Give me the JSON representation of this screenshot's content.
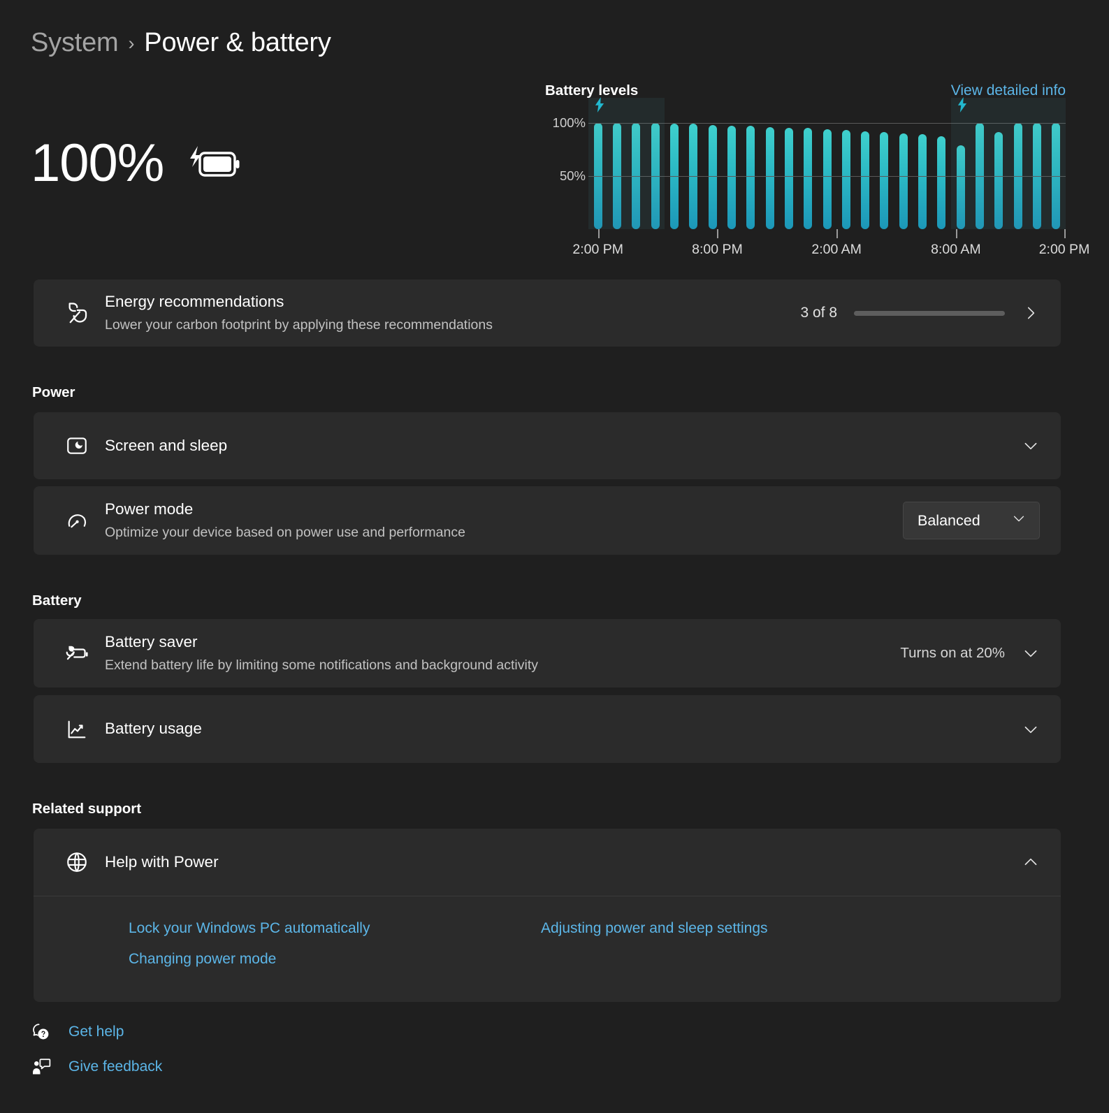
{
  "breadcrumb": {
    "parent": "System",
    "separator": "›",
    "current": "Power & battery"
  },
  "battery_status": {
    "percent_label": "100%",
    "icon": "battery-charging-icon"
  },
  "chart": {
    "title": "Battery levels",
    "detail_link": "View detailed info"
  },
  "chart_data": {
    "type": "bar",
    "title": "Battery levels",
    "xlabel": "",
    "ylabel": "",
    "ylim": [
      0,
      105
    ],
    "grid": true,
    "legend": false,
    "ytick_labels": [
      "100%",
      "50%"
    ],
    "ytick_values": [
      100,
      50
    ],
    "xtick_labels": [
      "2:00 PM",
      "8:00 PM",
      "2:00 AM",
      "8:00 AM",
      "2:00 PM"
    ],
    "xtick_hours": [
      0,
      6,
      12,
      18,
      24
    ],
    "bar_color": "#2bb8c4",
    "categories": [
      "2:00 PM",
      "3:00 PM",
      "4:00 PM",
      "5:00 PM",
      "6:00 PM",
      "7:00 PM",
      "8:00 PM",
      "9:00 PM",
      "10:00 PM",
      "11:00 PM",
      "12:00 AM",
      "1:00 AM",
      "2:00 AM",
      "3:00 AM",
      "4:00 AM",
      "5:00 AM",
      "6:00 AM",
      "7:00 AM",
      "8:00 AM",
      "9:00 AM",
      "10:00 AM",
      "11:00 AM",
      "12:00 PM",
      "1:00 PM",
      "2:00 PM"
    ],
    "values": [
      100,
      100,
      100,
      100,
      99,
      99,
      98,
      97,
      97,
      96,
      95,
      95,
      94,
      93,
      92,
      91,
      90,
      89,
      87,
      79,
      100,
      91,
      100,
      100,
      100
    ],
    "charging_periods": [
      {
        "start_index": 0,
        "end_index": 4,
        "label": "charging"
      },
      {
        "start_index": 19,
        "end_index": 25,
        "label": "charging"
      }
    ],
    "charging_icon": "lightning-bolt-icon"
  },
  "energy_card": {
    "icon": "leaf-icon",
    "title": "Energy recommendations",
    "subtitle": "Lower your carbon footprint by applying these recommendations",
    "progress_label": "3 of 8",
    "progress_value": 3,
    "progress_max": 8,
    "progress_color": "#0a7fe0",
    "chevron": "chevron-right-icon"
  },
  "power_section": {
    "heading": "Power",
    "items": [
      {
        "icon": "screen-sleep-icon",
        "title": "Screen and sleep",
        "subtitle": "",
        "value": "",
        "control": "chevron-down-icon"
      },
      {
        "icon": "power-mode-icon",
        "title": "Power mode",
        "subtitle": "Optimize your device based on power use and performance",
        "value": "Balanced",
        "control": "dropdown"
      }
    ]
  },
  "battery_section": {
    "heading": "Battery",
    "items": [
      {
        "icon": "battery-saver-icon",
        "title": "Battery saver",
        "subtitle": "Extend battery life by limiting some notifications and background activity",
        "value": "Turns on at 20%",
        "control": "chevron-down-icon"
      },
      {
        "icon": "battery-usage-icon",
        "title": "Battery usage",
        "subtitle": "",
        "value": "",
        "control": "chevron-down-icon"
      }
    ]
  },
  "related_support": {
    "heading": "Related support",
    "card": {
      "icon": "globe-help-icon",
      "title": "Help with Power",
      "control": "chevron-up-icon"
    },
    "links": [
      "Lock your Windows PC automatically",
      "Adjusting power and sleep settings",
      "Changing power mode"
    ]
  },
  "footer": {
    "get_help": {
      "icon": "help-question-icon",
      "label": "Get help"
    },
    "give_feedback": {
      "icon": "feedback-icon",
      "label": "Give feedback"
    }
  }
}
